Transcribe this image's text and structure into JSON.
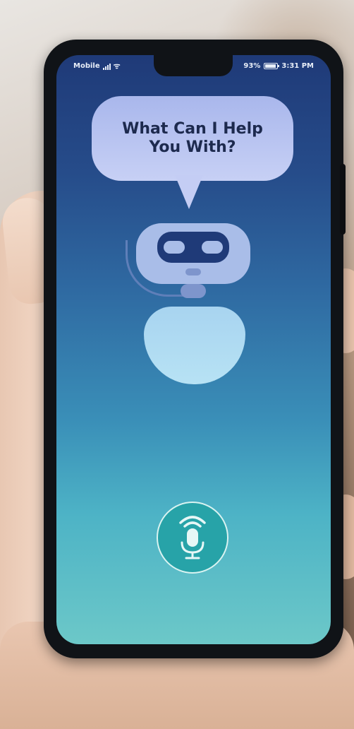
{
  "status_bar": {
    "carrier": "Mobile",
    "battery_percent": "93%",
    "time": "3:31 PM",
    "icons": [
      "signal-icon",
      "wifi-icon",
      "battery-icon"
    ]
  },
  "assistant": {
    "prompt_line1": "What Can I Help",
    "prompt_line2": "You With?"
  },
  "mic_button": {
    "icon": "microphone-icon",
    "accent_color": "#27a3a8"
  },
  "colors": {
    "screen_top": "#1f3a78",
    "screen_bottom": "#6cc8c8",
    "bubble": "#b9c4f1"
  }
}
